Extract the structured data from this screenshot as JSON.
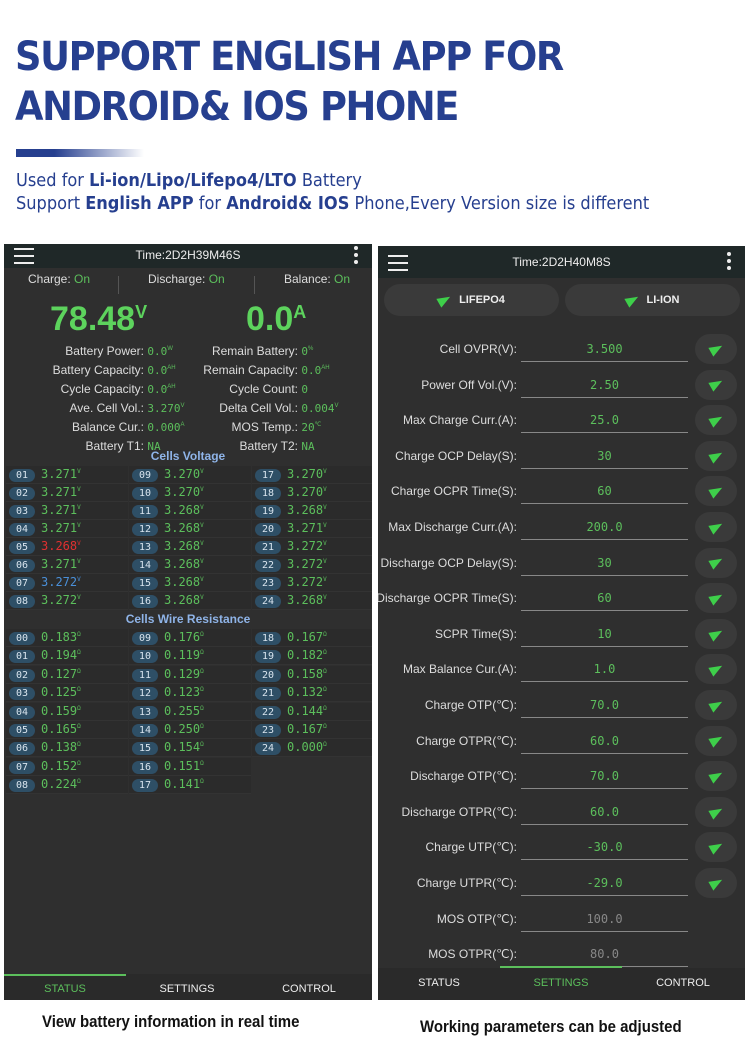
{
  "banner": {
    "title_line1": "SUPPORT ENGLISH APP FOR",
    "title_line2": "ANDROID& IOS PHONE",
    "sub1": [
      {
        "t": "Used for ",
        "b": false
      },
      {
        "t": "Li-ion/Lipo/Lifepo4/LTO",
        "b": true
      },
      {
        "t": " Battery",
        "b": false
      }
    ],
    "sub2": [
      {
        "t": "Support ",
        "b": false
      },
      {
        "t": "English APP",
        "b": true
      },
      {
        "t": " for ",
        "b": false
      },
      {
        "t": "Android& IOS",
        "b": true
      },
      {
        "t": " Phone,Every Version size is different",
        "b": false
      }
    ]
  },
  "left": {
    "time": "Time:2D2H39M46S",
    "status": [
      {
        "label": "Charge:",
        "value": "On"
      },
      {
        "label": "Discharge:",
        "value": "On"
      },
      {
        "label": "Balance:",
        "value": "On"
      }
    ],
    "voltage": "78.48",
    "voltage_unit": "V",
    "current": "0.0",
    "current_unit": "A",
    "info_left": [
      {
        "label": "Battery Power:",
        "value": "0.0",
        "unit": "W"
      },
      {
        "label": "Battery Capacity:",
        "value": "0.0",
        "unit": "AH"
      },
      {
        "label": "Cycle Capacity:",
        "value": "0.0",
        "unit": "AH"
      },
      {
        "label": "Ave. Cell Vol.:",
        "value": "3.270",
        "unit": "V"
      },
      {
        "label": "Balance Cur.:",
        "value": "0.000",
        "unit": "A"
      },
      {
        "label": "Battery T1:",
        "value": "NA",
        "unit": ""
      }
    ],
    "info_right": [
      {
        "label": "Remain Battery:",
        "value": "0",
        "unit": "%"
      },
      {
        "label": "Remain Capacity:",
        "value": "0.0",
        "unit": "AH"
      },
      {
        "label": "Cycle Count:",
        "value": "0",
        "unit": ""
      },
      {
        "label": "Delta Cell Vol.:",
        "value": "0.004",
        "unit": "V"
      },
      {
        "label": "MOS Temp.:",
        "value": "20",
        "unit": "℃"
      },
      {
        "label": "Battery T2:",
        "value": "NA",
        "unit": ""
      }
    ],
    "cells_title": "Cells Voltage",
    "cell_unit": "V",
    "cells": [
      [
        "01",
        "3.271"
      ],
      [
        "02",
        "3.271"
      ],
      [
        "03",
        "3.271"
      ],
      [
        "04",
        "3.271"
      ],
      [
        "05",
        "3.268"
      ],
      [
        "06",
        "3.271"
      ],
      [
        "07",
        "3.272"
      ],
      [
        "08",
        "3.272"
      ],
      [
        "09",
        "3.270"
      ],
      [
        "10",
        "3.270"
      ],
      [
        "11",
        "3.268"
      ],
      [
        "12",
        "3.268"
      ],
      [
        "13",
        "3.268"
      ],
      [
        "14",
        "3.268"
      ],
      [
        "15",
        "3.268"
      ],
      [
        "16",
        "3.268"
      ],
      [
        "17",
        "3.270"
      ],
      [
        "18",
        "3.270"
      ],
      [
        "19",
        "3.268"
      ],
      [
        "20",
        "3.271"
      ],
      [
        "21",
        "3.272"
      ],
      [
        "22",
        "3.272"
      ],
      [
        "23",
        "3.272"
      ],
      [
        "24",
        "3.268"
      ]
    ],
    "min_cell": "05",
    "max_cell": "07",
    "min_color": "#e03030",
    "max_color": "#4a8fd8",
    "res_title": "Cells Wire Resistance",
    "res_unit": "Ω",
    "res": [
      [
        "00",
        "0.183"
      ],
      [
        "01",
        "0.194"
      ],
      [
        "02",
        "0.127"
      ],
      [
        "03",
        "0.125"
      ],
      [
        "04",
        "0.159"
      ],
      [
        "05",
        "0.165"
      ],
      [
        "06",
        "0.138"
      ],
      [
        "07",
        "0.152"
      ],
      [
        "08",
        "0.224"
      ],
      [
        "09",
        "0.176"
      ],
      [
        "10",
        "0.119"
      ],
      [
        "11",
        "0.129"
      ],
      [
        "12",
        "0.123"
      ],
      [
        "13",
        "0.255"
      ],
      [
        "14",
        "0.250"
      ],
      [
        "15",
        "0.154"
      ],
      [
        "16",
        "0.151"
      ],
      [
        "17",
        "0.141"
      ],
      [
        "18",
        "0.167"
      ],
      [
        "19",
        "0.182"
      ],
      [
        "20",
        "0.158"
      ],
      [
        "21",
        "0.132"
      ],
      [
        "22",
        "0.144"
      ],
      [
        "23",
        "0.167"
      ],
      [
        "24",
        "0.000"
      ]
    ],
    "nav": [
      "STATUS",
      "SETTINGS",
      "CONTROL"
    ],
    "active_tab": 0,
    "caption": "View battery information in real time"
  },
  "right": {
    "time": "Time:2D2H40M8S",
    "presets": [
      "LIFEPO4",
      "LI-ION"
    ],
    "settings": [
      {
        "label": "Cell OVPR(V):",
        "value": "3.500"
      },
      {
        "label": "Power Off Vol.(V):",
        "value": "2.50"
      },
      {
        "label": "Max Charge Curr.(A):",
        "value": "25.0"
      },
      {
        "label": "Charge OCP Delay(S):",
        "value": "30"
      },
      {
        "label": "Charge OCPR Time(S):",
        "value": "60"
      },
      {
        "label": "Max Discharge Curr.(A):",
        "value": "200.0"
      },
      {
        "label": "Discharge OCP Delay(S):",
        "value": "30"
      },
      {
        "label": "Discharge OCPR Time(S):",
        "value": "60"
      },
      {
        "label": "SCPR Time(S):",
        "value": "10"
      },
      {
        "label": "Max Balance Cur.(A):",
        "value": "1.0"
      },
      {
        "label": "Charge OTP(℃):",
        "value": "70.0"
      },
      {
        "label": "Charge OTPR(℃):",
        "value": "60.0"
      },
      {
        "label": "Discharge OTP(℃):",
        "value": "70.0"
      },
      {
        "label": "Discharge OTPR(℃):",
        "value": "60.0"
      },
      {
        "label": "Charge UTP(℃):",
        "value": "-30.0"
      },
      {
        "label": "Charge UTPR(℃):",
        "value": "-29.0"
      },
      {
        "label": "MOS OTP(℃):",
        "value": "100.0",
        "dim": true
      },
      {
        "label": "MOS OTPR(℃):",
        "value": "80.0",
        "dim": true
      }
    ],
    "nav": [
      "STATUS",
      "SETTINGS",
      "CONTROL"
    ],
    "active_tab": 1,
    "caption": "Working parameters can be adjusted"
  }
}
